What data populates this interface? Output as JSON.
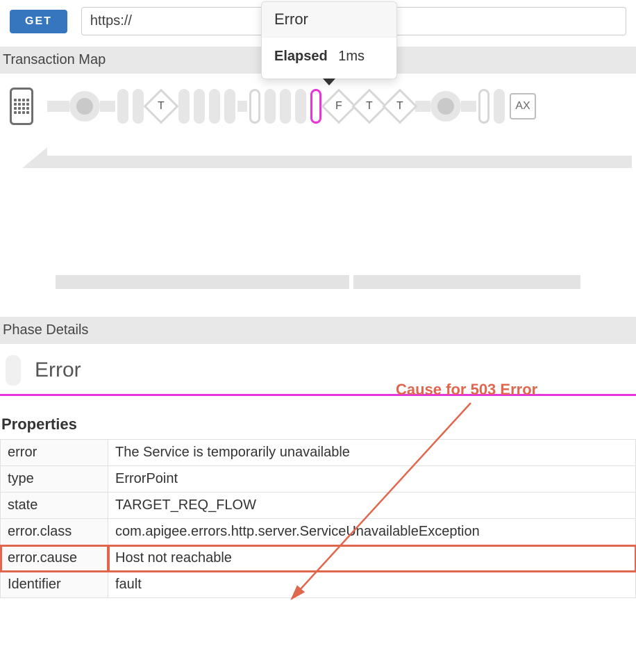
{
  "topbar": {
    "method": "GET",
    "url_value": "https://"
  },
  "tooltip": {
    "title": "Error",
    "elapsed_label": "Elapsed",
    "elapsed_value": "1ms"
  },
  "sections": {
    "transaction_map": "Transaction Map",
    "phase_details": "Phase Details"
  },
  "flow": {
    "diamond_t": "T",
    "diamond_f": "F",
    "chip_ax": "AX"
  },
  "phase": {
    "title": "Error",
    "properties_label": "Properties",
    "rows": [
      {
        "key": "error",
        "value": "The Service is temporarily unavailable"
      },
      {
        "key": "type",
        "value": "ErrorPoint"
      },
      {
        "key": "state",
        "value": "TARGET_REQ_FLOW"
      },
      {
        "key": "error.class",
        "value": "com.apigee.errors.http.server.ServiceUnavailableException"
      },
      {
        "key": "error.cause",
        "value": "Host not reachable"
      },
      {
        "key": "Identifier",
        "value": "fault"
      }
    ]
  },
  "annotation": {
    "label": "Cause for 503 Error"
  }
}
